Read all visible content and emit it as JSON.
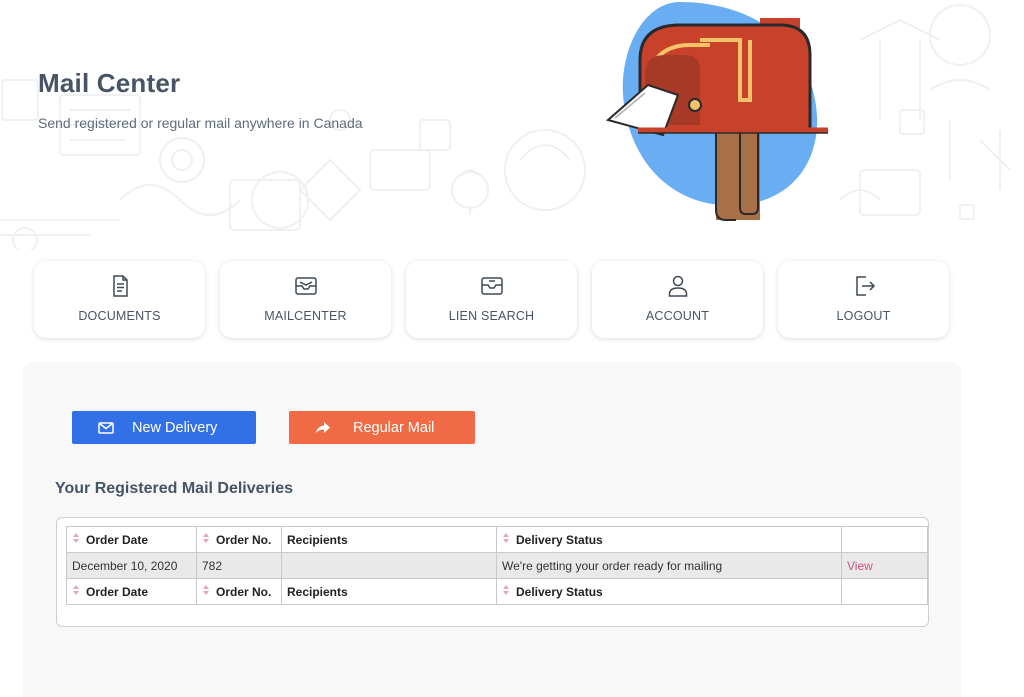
{
  "header": {
    "title": "Mail Center",
    "subtitle": "Send registered or regular mail anywhere in Canada"
  },
  "nav": [
    {
      "label": "DOCUMENTS",
      "icon": "document-icon"
    },
    {
      "label": "MAILCENTER",
      "icon": "mail-tray-icon"
    },
    {
      "label": "LIEN SEARCH",
      "icon": "inbox-search-icon"
    },
    {
      "label": "ACCOUNT",
      "icon": "user-icon"
    },
    {
      "label": "LOGOUT",
      "icon": "logout-icon"
    }
  ],
  "actions": {
    "new_delivery": "New Delivery",
    "regular_mail": "Regular Mail"
  },
  "deliveries": {
    "title": "Your Registered Mail Deliveries",
    "columns": [
      "Order Date",
      "Order No.",
      "Recipients",
      "Delivery Status"
    ],
    "rows": [
      {
        "order_date": "December 10, 2020",
        "order_no": "782",
        "recipients": "",
        "status": "We're getting your order ready for mailing",
        "action": "View"
      }
    ]
  },
  "colors": {
    "primary_blue": "#3170e6",
    "accent_orange": "#ef6a45",
    "mailbox_red": "#c8412b",
    "blob_blue": "#69aef3",
    "link_pink": "#d2527a"
  }
}
